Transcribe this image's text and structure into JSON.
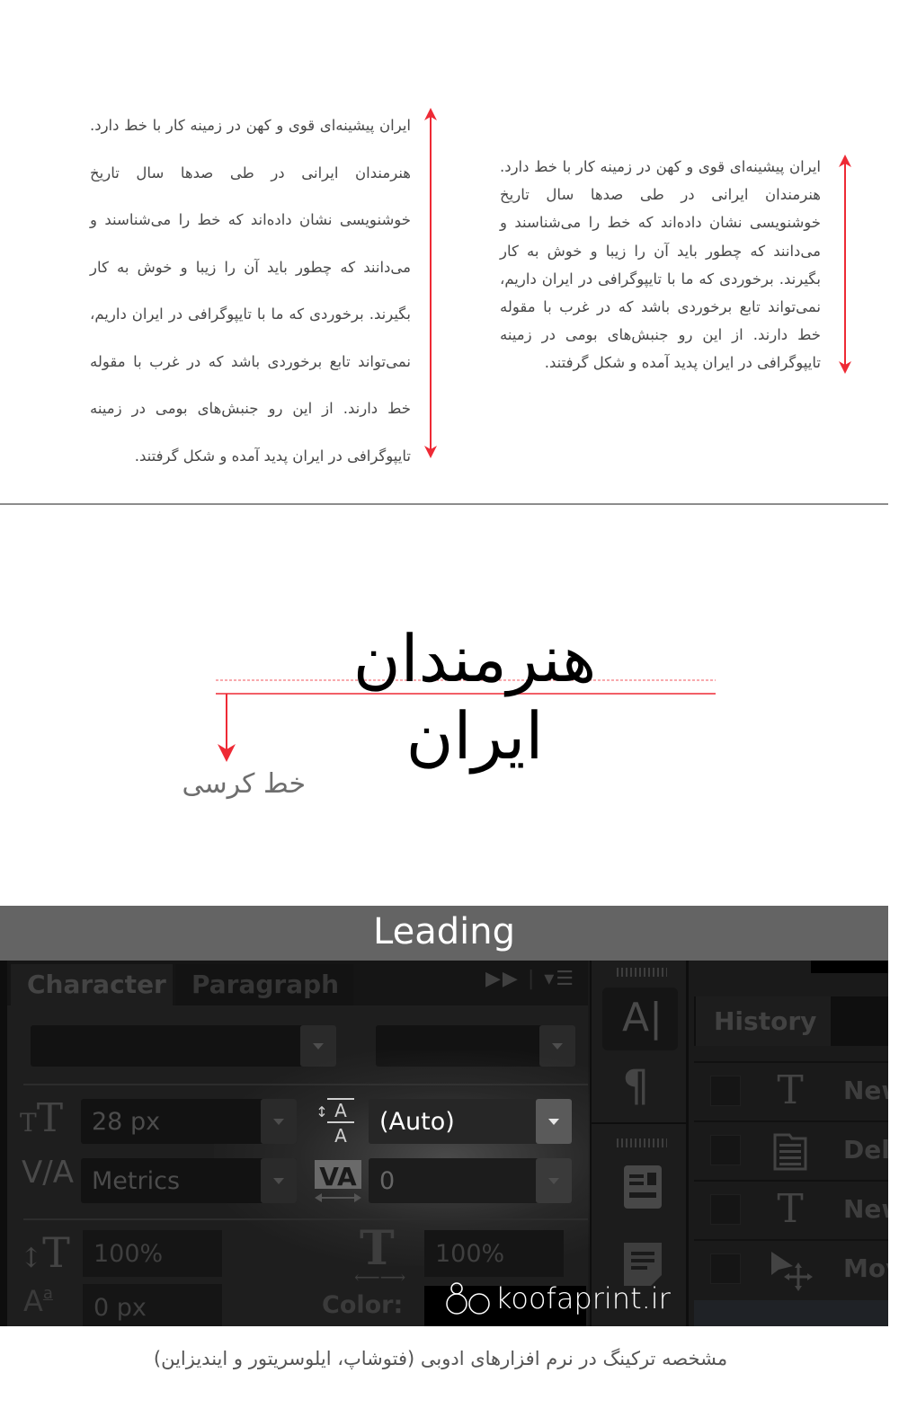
{
  "paragraph_samples": {
    "loose_leading_lines": [
      "ایران پیشینه‌ای قوی و کهن در زمینه کار با خط دارد.",
      "هنرمندان ایرانی در طی صدها سال تاریخ",
      "خوشنویسی نشان داده‌اند که خط را می‌شناسند و",
      "می‌دانند که چطور باید آن را زیبا و خوش به کار",
      "بگیرند. برخوردی که ما با تایپوگرافی در ایران داریم،",
      "نمی‌تواند تابع برخوردی باشد که در غرب با مقوله",
      "خط دارند. از این رو جنبش‌های بومی در زمینه",
      "تایپوگرافی در ایران پدید آمده و شکل گرفتند."
    ],
    "tight_leading_lines": [
      "ایران پیشینه‌ای قوی و کهن در زمینه کار با خط دارد.",
      "هنرمندان ایرانی در طی صدها سال تاریخ",
      "خوشنویسی نشان داده‌اند که خط را می‌شناسند و",
      "می‌دانند که چطور باید آن را زیبا و خوش به کار",
      "بگیرند. برخوردی که ما با تایپوگرافی در ایران داریم،",
      "نمی‌تواند تابع برخوردی باشد که در غرب با مقوله",
      "خط دارند. از این رو جنبش‌های بومی در زمینه",
      "تایپوگرافی در ایران پدید آمده و شکل گرفتند."
    ],
    "arrow_color": "#ee2a35"
  },
  "baseline_demo": {
    "sample_text": "هنرمندان ایران",
    "label": "خط کرسی",
    "line_color": "#ee2a35"
  },
  "leading_banner": {
    "title": "Leading",
    "background": "#646464"
  },
  "character_panel": {
    "tabs": [
      {
        "label": "Character",
        "active": true
      },
      {
        "label": "Paragraph",
        "active": false
      }
    ],
    "font_family": "",
    "font_style": "",
    "font_size": "28 px",
    "leading": "(Auto)",
    "kerning": "Metrics",
    "tracking": "0",
    "vertical_scale": "100%",
    "horizontal_scale": "100%",
    "baseline_shift": "0 px",
    "color_label": "Color:"
  },
  "history_panel": {
    "tab_label": "History",
    "rows": [
      {
        "icon": "type-icon",
        "label": "New"
      },
      {
        "icon": "document-icon",
        "label": "Dele"
      },
      {
        "icon": "type-icon",
        "label": "New"
      },
      {
        "icon": "move-icon",
        "label": "Mov"
      }
    ]
  },
  "watermark": "koofaprint.ir",
  "caption": "مشخصه ترکینگ در نرم افزارهای ادوبی (فتوشاپ، ایلوسریتور و ایندیزاین)"
}
